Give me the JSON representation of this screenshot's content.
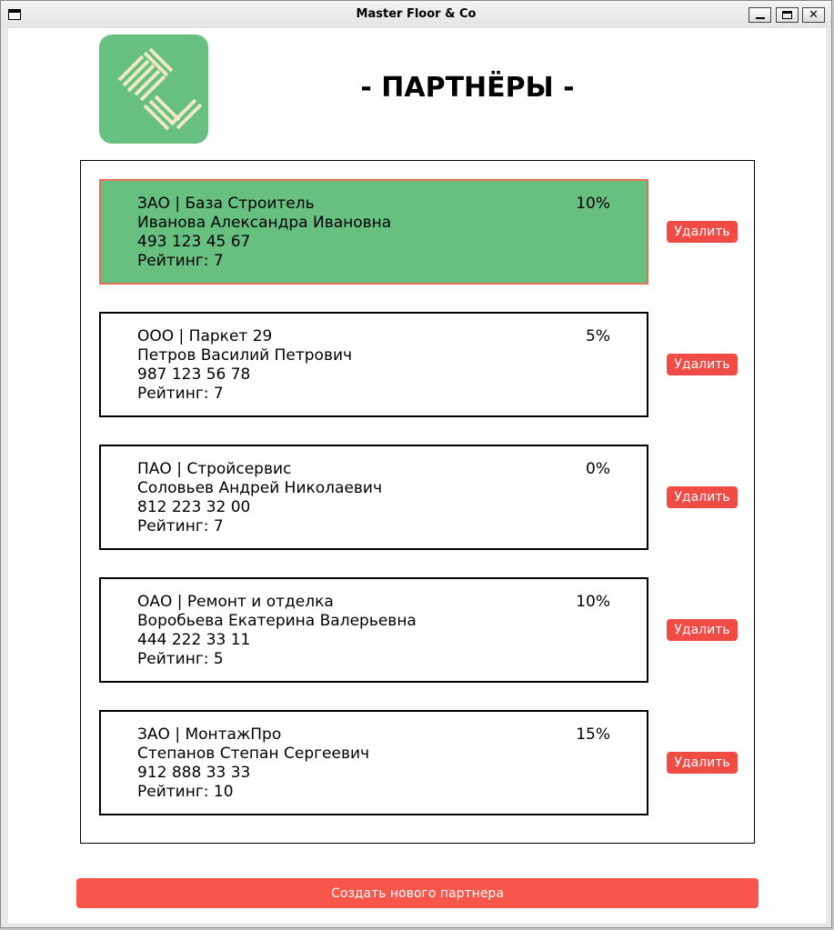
{
  "window": {
    "title": "Master Floor & Co"
  },
  "header": {
    "logo_icon": "parquet-logo-icon",
    "title": "- ПАРТНЁРЫ -"
  },
  "colors": {
    "accent_green": "#67bf80",
    "danger_red": "#f14b45",
    "create_red": "#f8564a",
    "selected_border": "#e57058"
  },
  "partners": [
    {
      "type_name": "ЗАО | База Строитель",
      "director": "Иванова Александра Ивановна",
      "phone": "493 123 45 67",
      "rating": "Рейтинг: 7",
      "discount": "10%",
      "delete_label": "Удалить",
      "selected": true
    },
    {
      "type_name": "ООО | Паркет 29",
      "director": "Петров Василий Петрович",
      "phone": "987 123 56 78",
      "rating": "Рейтинг: 7",
      "discount": "5%",
      "delete_label": "Удалить",
      "selected": false
    },
    {
      "type_name": "ПАО | Стройсервис",
      "director": "Соловьев Андрей Николаевич",
      "phone": "812 223 32 00",
      "rating": "Рейтинг: 7",
      "discount": "0%",
      "delete_label": "Удалить",
      "selected": false
    },
    {
      "type_name": "ОАО | Ремонт и отделка",
      "director": "Воробьева Екатерина Валерьевна",
      "phone": "444 222 33 11",
      "rating": "Рейтинг: 5",
      "discount": "10%",
      "delete_label": "Удалить",
      "selected": false
    },
    {
      "type_name": "ЗАО | МонтажПро",
      "director": "Степанов Степан Сергеевич",
      "phone": "912 888 33 33",
      "rating": "Рейтинг: 10",
      "discount": "15%",
      "delete_label": "Удалить",
      "selected": false
    }
  ],
  "actions": {
    "create_label": "Создать нового партнера"
  }
}
